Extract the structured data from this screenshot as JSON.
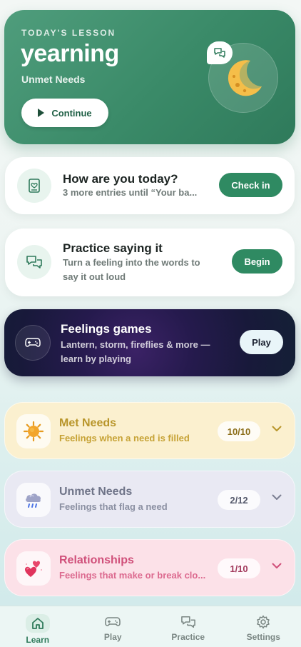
{
  "lesson": {
    "eyebrow": "TODAY'S LESSON",
    "word": "yearning",
    "category": "Unmet Needs",
    "continue_label": "Continue"
  },
  "checkin": {
    "title": "How are you today?",
    "subtitle": "3 more entries until “Your ba...",
    "button": "Check in"
  },
  "practice": {
    "title": "Practice saying it",
    "subtitle_line1": "Turn a feeling into the words to",
    "subtitle_line2": "say it out loud",
    "button": "Begin"
  },
  "games": {
    "title": "Feelings games",
    "subtitle_line1": "Lantern, storm, fireflies & more —",
    "subtitle_line2": "learn by playing",
    "button": "Play"
  },
  "categories": [
    {
      "title": "Met Needs",
      "subtitle": "Feelings when a need is filled",
      "count": "10/10",
      "icon": "sun-icon",
      "color": "#b8952a",
      "bg": "#fbf0cf"
    },
    {
      "title": "Unmet Needs",
      "subtitle": "Feelings that flag a need",
      "count": "2/12",
      "icon": "rain-cloud-icon",
      "color": "#6f7488",
      "bg": "#e9e9f3"
    },
    {
      "title": "Relationships",
      "subtitle": "Feelings that make or break clo...",
      "count": "1/10",
      "icon": "hearts-icon",
      "color": "#d0507a",
      "bg": "#fce1e8"
    }
  ],
  "nav": [
    {
      "label": "Learn",
      "icon": "home-icon",
      "active": true
    },
    {
      "label": "Play",
      "icon": "gamepad-icon",
      "active": false
    },
    {
      "label": "Practice",
      "icon": "chat-bubbles-icon",
      "active": false
    },
    {
      "label": "Settings",
      "icon": "gear-icon",
      "active": false
    }
  ],
  "colors": {
    "accent": "#2f8a62",
    "hero": "#3a8a68",
    "games_bg": "#1f1a45"
  }
}
